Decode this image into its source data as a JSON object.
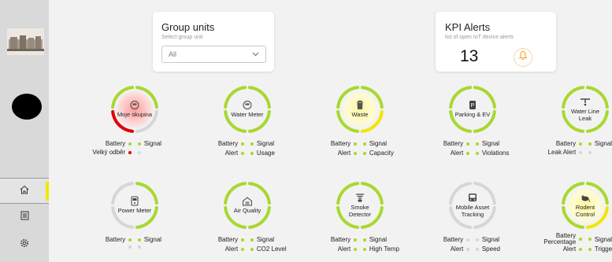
{
  "colors": {
    "accent_green": "#a8d82f",
    "alert_red": "#e00000",
    "warning_yellow": "#f2e600",
    "bell_orange": "#f39c12"
  },
  "group_units": {
    "title": "Group units",
    "subtitle": "Select group unit",
    "selected": "All"
  },
  "kpi": {
    "title": "KPI Alerts",
    "subtitle": "list of open IoT device alerts",
    "count": "13"
  },
  "sidebar": {
    "items": [
      {
        "icon": "home-icon",
        "active": true
      },
      {
        "icon": "list-icon",
        "active": false
      },
      {
        "icon": "gear-icon",
        "active": false
      }
    ]
  },
  "tiles": [
    {
      "id": "moje-skupina",
      "name_lines": [
        "Moje skupina"
      ],
      "icon": "meter-icon",
      "tint": "red",
      "ring": "red-grey",
      "rows": [
        {
          "left": "Battery",
          "l": "green",
          "r": "green",
          "right": "Signal"
        },
        {
          "left": "Velký odběr",
          "l": "red",
          "r": "blue",
          "right": ""
        }
      ]
    },
    {
      "id": "water-meter",
      "name_lines": [
        "Water Meter"
      ],
      "icon": "meter-icon",
      "tint": "none",
      "ring": "green",
      "rows": [
        {
          "left": "Battery",
          "l": "green",
          "r": "green",
          "right": "Signal"
        },
        {
          "left": "Alert",
          "l": "green",
          "r": "green",
          "right": "Usage"
        }
      ]
    },
    {
      "id": "waste",
      "name_lines": [
        "Waste"
      ],
      "icon": "bin-icon",
      "tint": "yellow",
      "ring": "green-yellow",
      "rows": [
        {
          "left": "Battery",
          "l": "green",
          "r": "green",
          "right": "Signal"
        },
        {
          "left": "Alert",
          "l": "green",
          "r": "green",
          "right": "Capacity"
        }
      ]
    },
    {
      "id": "parking-ev",
      "name_lines": [
        "Parking & EV"
      ],
      "icon": "parking-icon",
      "tint": "none",
      "ring": "green",
      "rows": [
        {
          "left": "Battery",
          "l": "green",
          "r": "green",
          "right": "Signal"
        },
        {
          "left": "Alert",
          "l": "green",
          "r": "green",
          "right": "Violations"
        }
      ]
    },
    {
      "id": "water-line-leak",
      "name_lines": [
        "Water Line",
        "Leak"
      ],
      "icon": "pipe-icon",
      "tint": "none",
      "ring": "green",
      "rows": [
        {
          "left": "Battery",
          "l": "green",
          "r": "green",
          "right": "Signal"
        },
        {
          "left": "Leak Alert",
          "l": "grey",
          "r": "grey",
          "right": ""
        }
      ]
    },
    {
      "id": "power-meter",
      "name_lines": [
        "Power Meter"
      ],
      "icon": "power-icon",
      "tint": "none",
      "ring": "green-grey",
      "rows": [
        {
          "left": "Battery",
          "l": "green",
          "r": "green",
          "right": "Signal"
        },
        {
          "left": "",
          "l": "grey",
          "r": "grey",
          "right": ""
        }
      ]
    },
    {
      "id": "air-quality",
      "name_lines": [
        "Air Quality"
      ],
      "icon": "house-icon",
      "tint": "none",
      "ring": "green",
      "rows": [
        {
          "left": "Battery",
          "l": "green",
          "r": "green",
          "right": "Signal"
        },
        {
          "left": "Alert",
          "l": "green",
          "r": "green",
          "right": "CO2 Level"
        }
      ]
    },
    {
      "id": "smoke-detector",
      "name_lines": [
        "Smoke",
        "Detector"
      ],
      "icon": "smoke-icon",
      "tint": "none",
      "ring": "green",
      "rows": [
        {
          "left": "Battery",
          "l": "green",
          "r": "green",
          "right": "Signal"
        },
        {
          "left": "Alert",
          "l": "green",
          "r": "green",
          "right": "High Temp"
        }
      ]
    },
    {
      "id": "mobile-asset-tracking",
      "name_lines": [
        "Mobile Asset",
        "Tracking"
      ],
      "icon": "bus-icon",
      "tint": "none",
      "ring": "grey",
      "rows": [
        {
          "left": "Battery",
          "l": "grey",
          "r": "grey",
          "right": "Signal"
        },
        {
          "left": "Alert",
          "l": "grey",
          "r": "grey",
          "right": "Speed"
        }
      ]
    },
    {
      "id": "rodent-control",
      "name_lines": [
        "Rodent",
        "Control"
      ],
      "icon": "rodent-icon",
      "tint": "yellow",
      "ring": "green-yellow",
      "rows": [
        {
          "left": "Battery",
          "left2": "Percentage",
          "l": "green",
          "r": "green",
          "right": "Signal"
        },
        {
          "left": "Alert",
          "l": "green",
          "r": "green",
          "right": "Triggered"
        }
      ]
    }
  ]
}
